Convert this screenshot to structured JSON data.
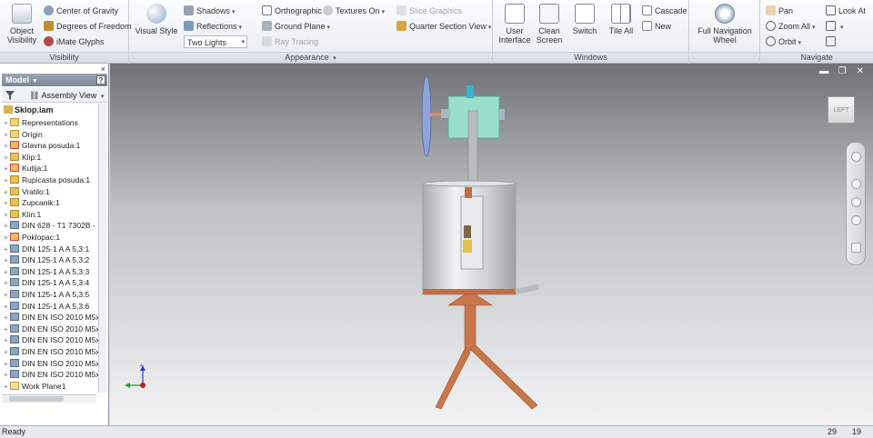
{
  "ribbon": {
    "visibility": {
      "label": "Visibility",
      "object_visibility": "Object\nVisibility",
      "center_of_gravity": "Center of Gravity",
      "degrees_of_freedom": "Degrees of Freedom",
      "imate_glyphs": "iMate Glyphs"
    },
    "appearance": {
      "label": "Appearance",
      "visual_style": "Visual Style",
      "shadows": "Shadows",
      "reflections": "Reflections",
      "lighting_value": "Two Lights",
      "orthographic": "Orthographic",
      "ground_plane": "Ground Plane",
      "ray_tracing": "Ray Tracing",
      "textures_on": "Textures On",
      "slice_graphics": "Slice Graphics",
      "quarter_section_view": "Quarter Section View"
    },
    "windows": {
      "label": "Windows",
      "user_interface": "User\nInterface",
      "clean_screen": "Clean\nScreen",
      "switch": "Switch",
      "tile_all": "Tile All",
      "cascade": "Cascade",
      "new": "New"
    },
    "navigation_wheel": {
      "full_navigation_wheel": "Full Navigation\nWheel"
    },
    "navigate": {
      "label": "Navigate",
      "pan": "Pan",
      "zoom_all": "Zoom All",
      "orbit": "Orbit",
      "look_at": "Look At"
    }
  },
  "browser": {
    "title": "Model",
    "help": "?",
    "view_mode": "Assembly View",
    "root": "Sklop.iam",
    "items": [
      {
        "label": "Representations",
        "type": "folder"
      },
      {
        "label": "Origin",
        "type": "folder"
      },
      {
        "label": "Glavna posuda:1",
        "type": "part-constrained"
      },
      {
        "label": "Klip:1",
        "type": "part"
      },
      {
        "label": "Kutija:1",
        "type": "part-constrained"
      },
      {
        "label": "Rupicasta posuda:1",
        "type": "part"
      },
      {
        "label": "Vratilo:1",
        "type": "part"
      },
      {
        "label": "Zupcanik:1",
        "type": "part"
      },
      {
        "label": "Klin:1",
        "type": "part"
      },
      {
        "label": "DIN 628 - T1 7302B -",
        "type": "std"
      },
      {
        "label": "Poklopac:1",
        "type": "part-constrained"
      },
      {
        "label": "DIN 125-1 A A 5,3:1",
        "type": "std"
      },
      {
        "label": "DIN 125-1 A A 5,3:2",
        "type": "std"
      },
      {
        "label": "DIN 125-1 A A 5,3:3",
        "type": "std"
      },
      {
        "label": "DIN 125-1 A A 5,3:4",
        "type": "std"
      },
      {
        "label": "DIN 125-1 A A 5,3:5",
        "type": "std"
      },
      {
        "label": "DIN 125-1 A A 5,3:6",
        "type": "std"
      },
      {
        "label": "DIN EN ISO 2010 M5x",
        "type": "std"
      },
      {
        "label": "DIN EN ISO 2010 M5x",
        "type": "std"
      },
      {
        "label": "DIN EN ISO 2010 M5x",
        "type": "std"
      },
      {
        "label": "DIN EN ISO 2010 M5x",
        "type": "std"
      },
      {
        "label": "DIN EN ISO 2010 M5x",
        "type": "std"
      },
      {
        "label": "DIN EN ISO 2010 M5x",
        "type": "std"
      },
      {
        "label": "Work Plane1",
        "type": "plane"
      }
    ]
  },
  "viewport": {
    "viewcube_label": "LEFT"
  },
  "status": {
    "text": "Ready",
    "x": "29",
    "y": "19"
  },
  "colors": {
    "accent": "#7c8898",
    "copper": "#c8774a",
    "tank_silver": "#cfd1d3",
    "gearbox_teal": "#8fd6c2"
  }
}
